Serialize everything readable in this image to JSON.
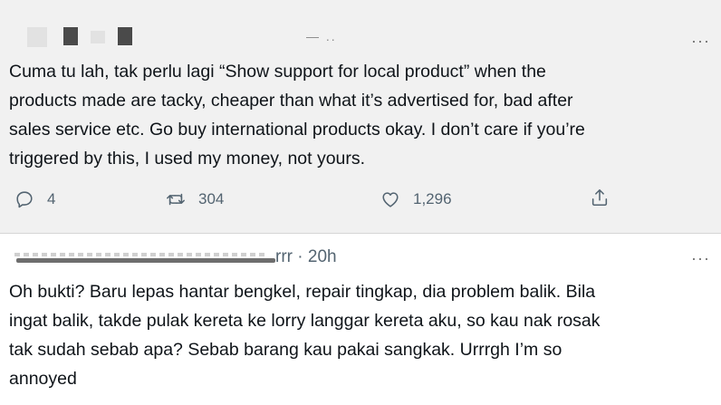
{
  "tweet1": {
    "header_fragment": "— ..",
    "more_label": "···",
    "lines": [
      "Cuma tu lah, tak perlu lagi “Show support for local product” when the",
      "products made are tacky, cheaper than what it’s advertised for, bad after",
      "sales service etc. Go buy international products okay. I don’t care if you’re",
      "triggered by this, I used my money, not yours."
    ],
    "actions": {
      "reply_count": "4",
      "retweet_count": "304",
      "like_count": "1,296",
      "reply_icon": "reply-icon",
      "retweet_icon": "retweet-icon",
      "like_icon": "heart-icon",
      "share_icon": "share-icon"
    }
  },
  "tweet2": {
    "handle_tail": "rrr",
    "separator": "·",
    "time": "20h",
    "more_label": "···",
    "lines": [
      "Oh bukti? Baru lepas hantar bengkel, repair tingkap, dia problem balik. Bila",
      "ingat balik, takde pulak kereta ke lorry langgar kereta aku, so kau nak rosak",
      "tak sudah sebab apa? Sebab barang kau pakai sangkak. Urrrgh I’m so",
      "annoyed"
    ]
  },
  "colors": {
    "tweet1_background": "#f1f1f1",
    "text": "#0f1419",
    "secondary": "#536471"
  }
}
